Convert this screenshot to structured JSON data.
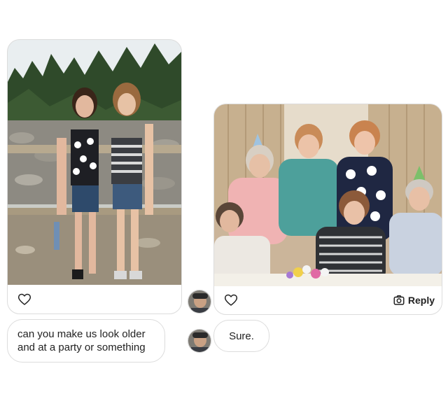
{
  "left_message": {
    "text": "can you make us look older\nand at a party or something"
  },
  "right_message": {
    "text": "Sure.",
    "reply_label": "Reply"
  },
  "icons": {
    "like": "heart-outline-icon",
    "reply": "camera-icon"
  },
  "colors": {
    "card_border": "#dcdcdc",
    "text": "#222222"
  }
}
